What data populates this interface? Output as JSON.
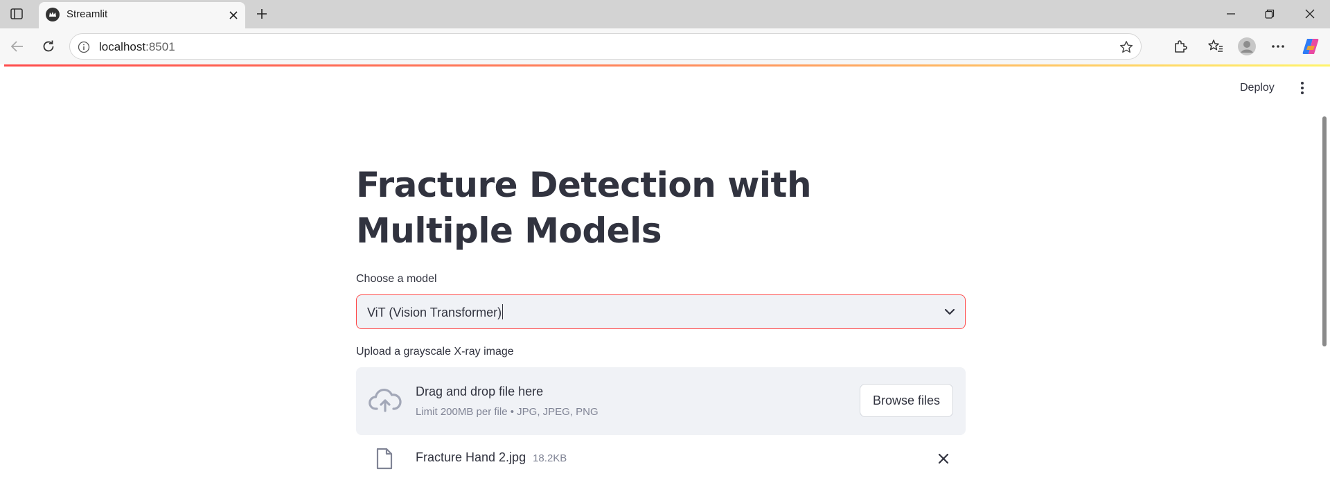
{
  "browser": {
    "tab_title": "Streamlit",
    "url_host": "localhost",
    "url_port": ":8501",
    "icons": [
      "sidebar-toggle-icon",
      "streamlit-favicon",
      "close-icon",
      "plus-icon",
      "minimize-icon",
      "restore-icon",
      "window-close-icon",
      "back-icon",
      "reload-icon",
      "info-icon",
      "star-icon",
      "extensions-icon",
      "favorites-icon",
      "profile-icon",
      "more-icon",
      "copilot-icon"
    ]
  },
  "header": {
    "deploy_label": "Deploy",
    "menu_icon": "kebab-menu-icon"
  },
  "main": {
    "title": "Fracture Detection with Multiple Models",
    "model_select": {
      "label": "Choose a model",
      "value": "ViT (Vision Transformer)"
    },
    "uploader": {
      "label": "Upload a grayscale X-ray image",
      "dropzone_title": "Drag and drop file here",
      "dropzone_limit": "Limit 200MB per file • JPG, JPEG, PNG",
      "browse_label": "Browse files"
    },
    "uploaded_file": {
      "name": "Fracture Hand 2.jpg",
      "size": "18.2KB"
    }
  },
  "colors": {
    "accent": "#ff4b4b",
    "text": "#31333f",
    "muted": "#808495",
    "widget_bg": "#f0f2f6"
  }
}
